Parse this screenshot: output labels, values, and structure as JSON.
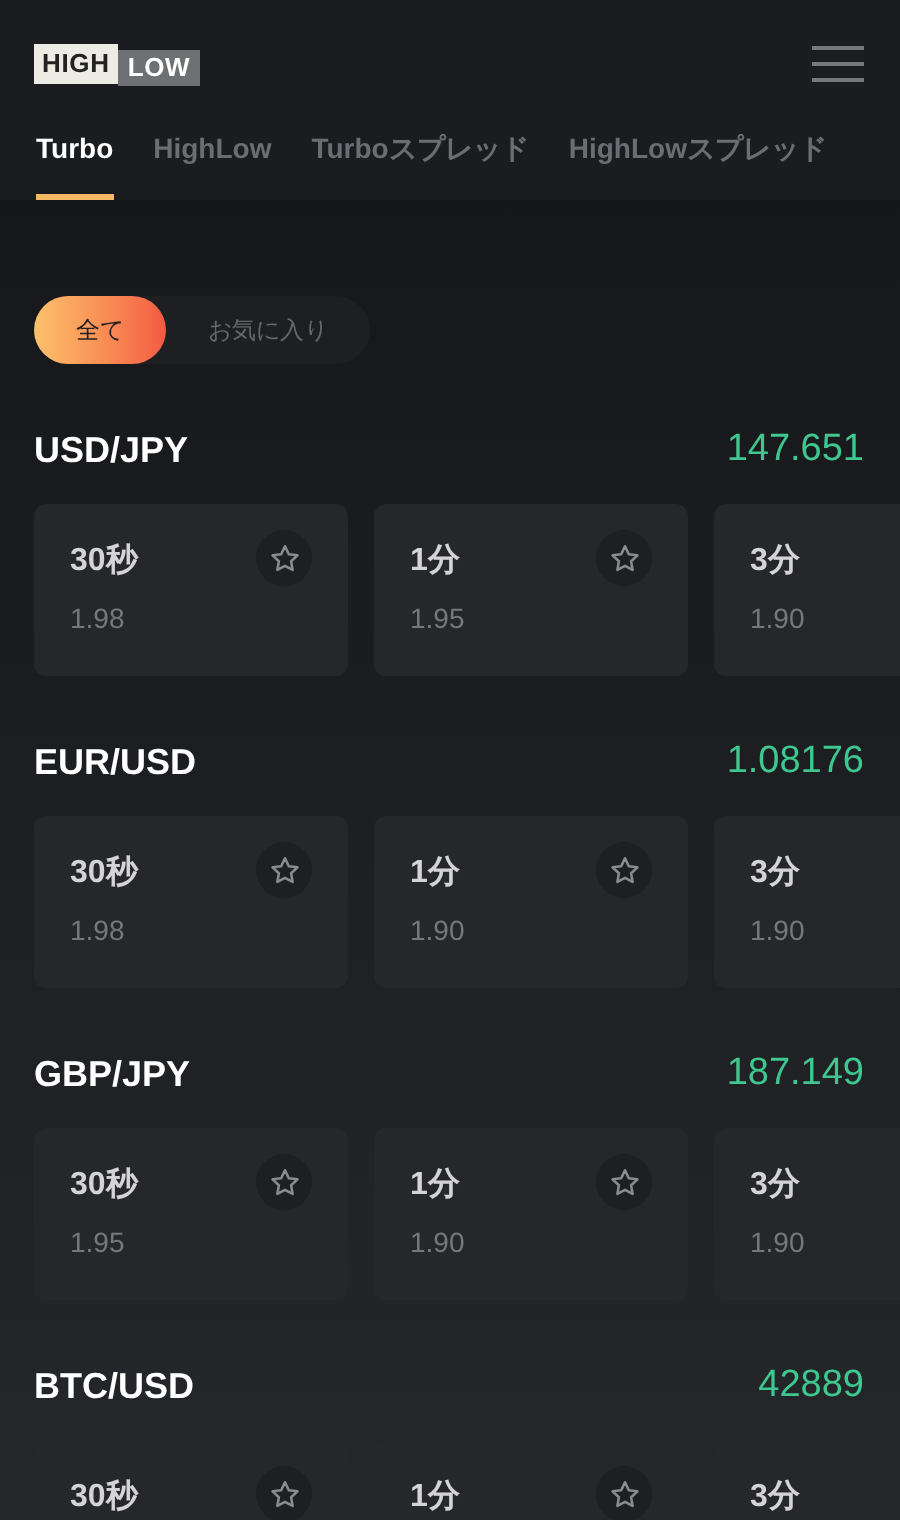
{
  "logo": {
    "left": "HIGH",
    "right": "LOW"
  },
  "tabs": [
    {
      "label": "Turbo",
      "selected": true
    },
    {
      "label": "HighLow",
      "selected": false
    },
    {
      "label": "Turboスプレッド",
      "selected": false
    },
    {
      "label": "HighLowスプレッド",
      "selected": false
    }
  ],
  "filters": [
    {
      "label": "全て",
      "selected": true
    },
    {
      "label": "お気に入り",
      "selected": false
    }
  ],
  "pairs": [
    {
      "name": "USD/JPY",
      "rate": "147.651",
      "options": [
        {
          "duration": "30秒",
          "payout": "1.98",
          "favorite": false
        },
        {
          "duration": "1分",
          "payout": "1.95",
          "favorite": false
        },
        {
          "duration": "3分",
          "payout": "1.90"
        }
      ]
    },
    {
      "name": "EUR/USD",
      "rate": "1.08176",
      "options": [
        {
          "duration": "30秒",
          "payout": "1.98",
          "favorite": false
        },
        {
          "duration": "1分",
          "payout": "1.90",
          "favorite": false
        },
        {
          "duration": "3分",
          "payout": "1.90"
        }
      ]
    },
    {
      "name": "GBP/JPY",
      "rate": "187.149",
      "options": [
        {
          "duration": "30秒",
          "payout": "1.95",
          "favorite": false
        },
        {
          "duration": "1分",
          "payout": "1.90",
          "favorite": false
        },
        {
          "duration": "3分",
          "payout": "1.90"
        }
      ]
    },
    {
      "name": "BTC/USD",
      "rate": "42889",
      "options": [
        {
          "duration": "30秒",
          "favorite": false
        },
        {
          "duration": "1分",
          "favorite": false
        },
        {
          "duration": "3分"
        }
      ]
    }
  ]
}
